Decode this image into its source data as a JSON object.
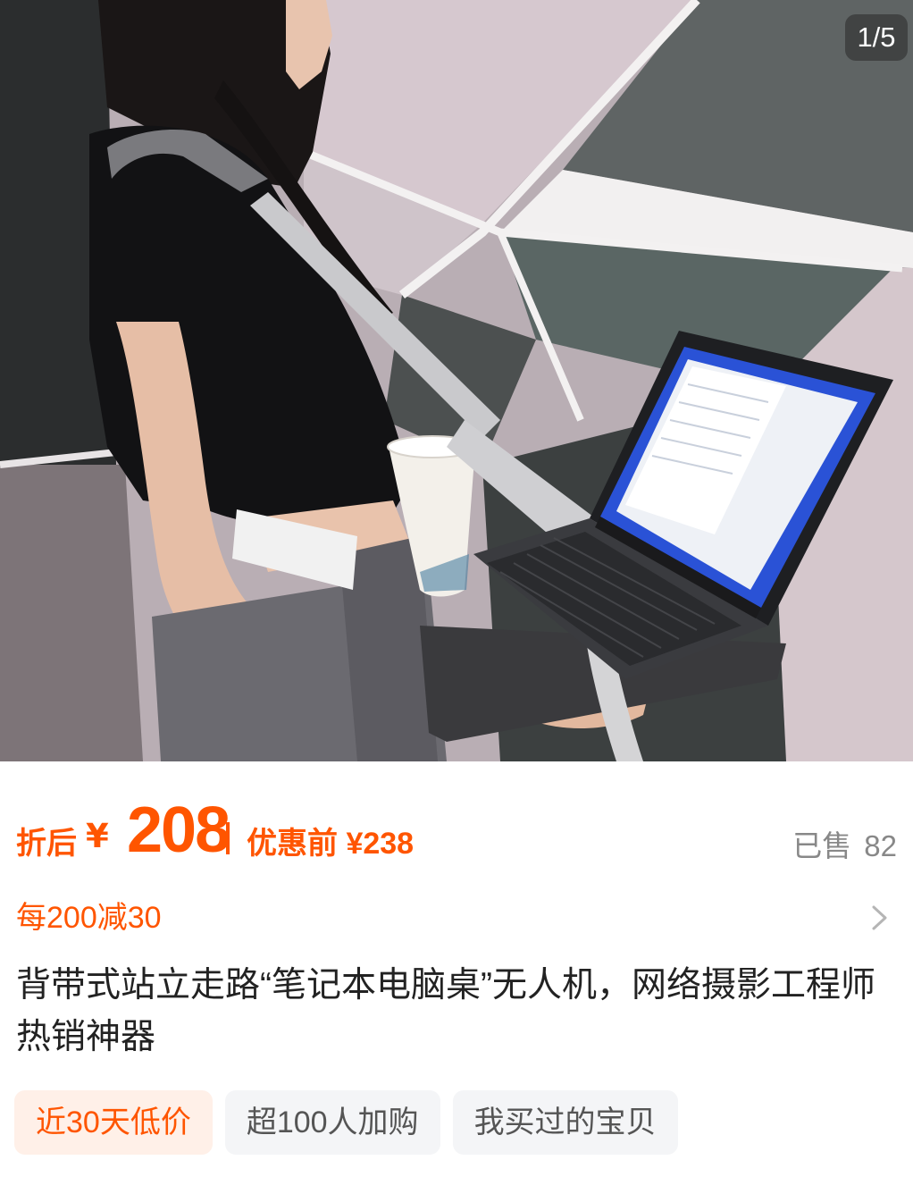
{
  "gallery": {
    "counter": "1/5",
    "image_description": "product-photo"
  },
  "price": {
    "after_label": "折后",
    "currency": "¥",
    "after_value": "208",
    "before_label": "优惠前",
    "before_value": "¥238",
    "sold_label": "已售",
    "sold_count": "82"
  },
  "promo": {
    "text": "每200减30",
    "chevron_icon": "chevron-right-icon"
  },
  "product": {
    "title": "背带式站立走路“笔记本电脑桌”无人机，网络摄影工程师热销神器"
  },
  "tags": [
    {
      "label": "近30天低价"
    },
    {
      "label": "超100人加购"
    },
    {
      "label": "我买过的宝贝"
    }
  ],
  "colors": {
    "accent": "#ff5500",
    "muted": "#888888",
    "tag_bg": "#f4f5f7",
    "tag_hot_bg": "#fff0e8"
  }
}
